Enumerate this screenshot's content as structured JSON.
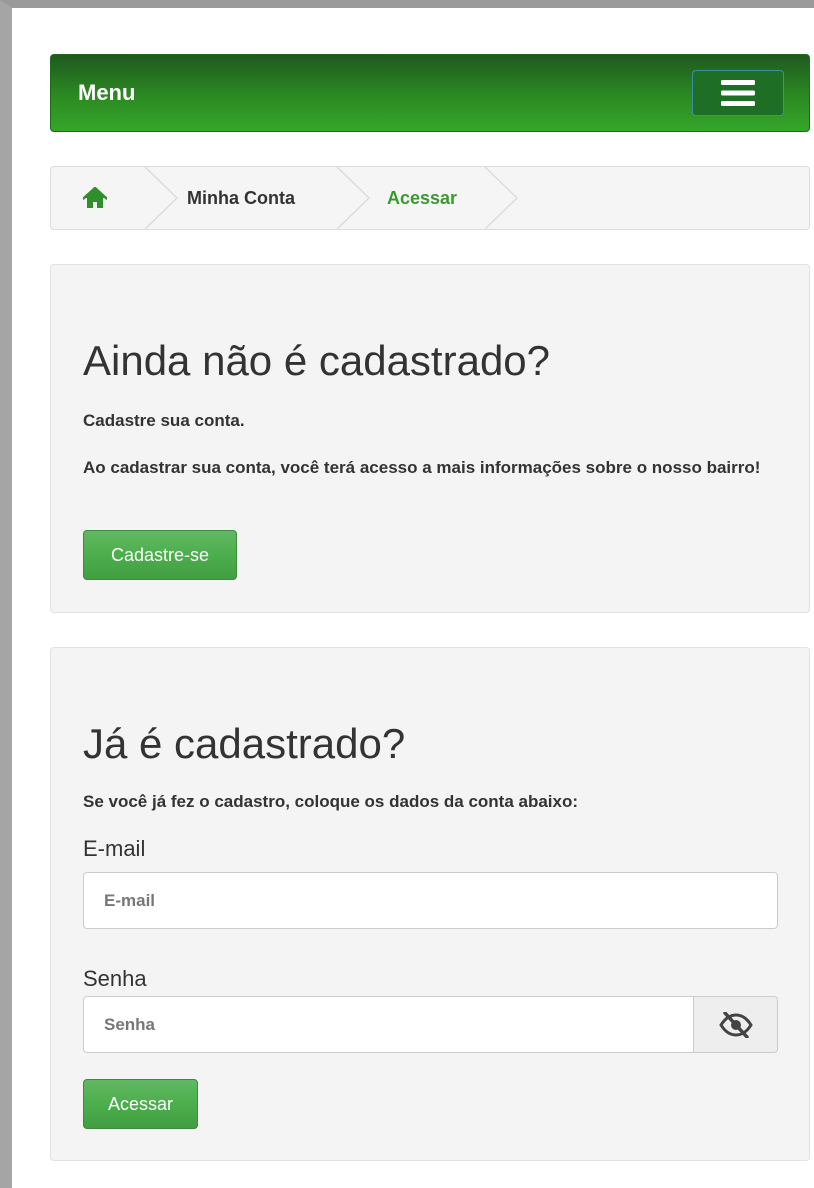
{
  "navbar": {
    "brand": "Menu",
    "toggle_icon": "hamburger-icon"
  },
  "breadcrumb": {
    "home_icon": "home-icon",
    "items": [
      "Minha Conta",
      "Acessar"
    ]
  },
  "register_panel": {
    "title": "Ainda não é cadastrado?",
    "subtitle": "Cadastre sua conta.",
    "description": "Ao cadastrar sua conta, você terá acesso a mais informações sobre o nosso bairro!",
    "button_label": "Cadastre-se"
  },
  "login_panel": {
    "title": "Já é cadastrado?",
    "instructions": "Se você já fez o cadastro, coloque os dados da conta abaixo:",
    "email_label": "E-mail",
    "email_placeholder": "E-mail",
    "email_value": "",
    "password_label": "Senha",
    "password_placeholder": "Senha",
    "password_value": "",
    "toggle_visibility_icon": "eye-slash-icon",
    "submit_label": "Acessar"
  },
  "colors": {
    "navbar_green": "#2c8a22",
    "button_green": "#4cae4c",
    "active_crumb": "#3a9a2e",
    "panel_bg": "#f4f4f4"
  }
}
